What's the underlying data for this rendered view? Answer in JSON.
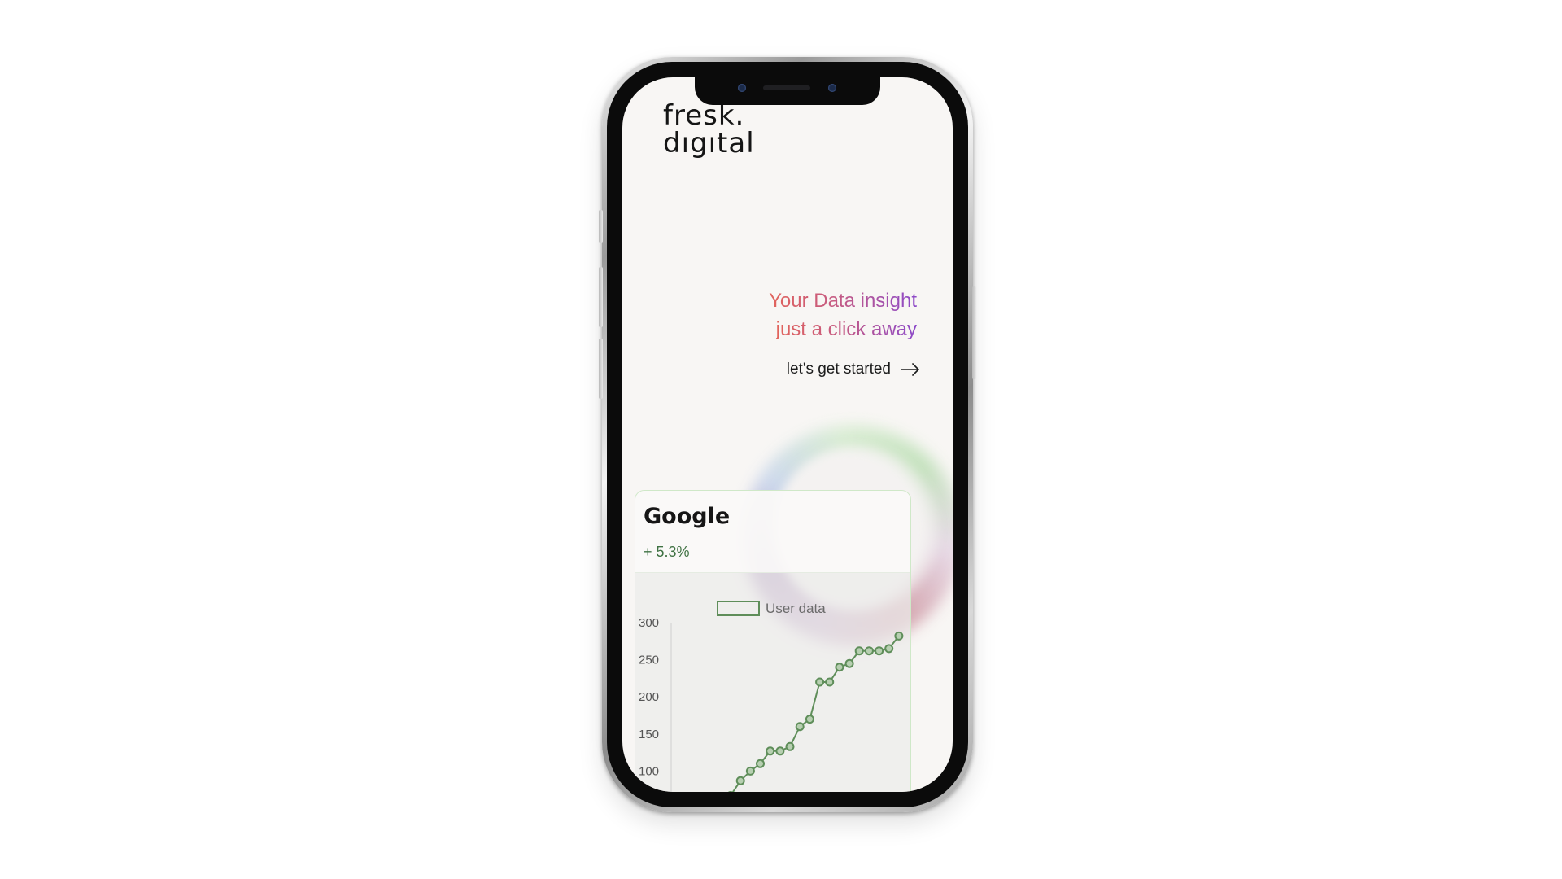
{
  "brand": {
    "logo_line1": "fresk.",
    "logo_line2": "dıgıtal"
  },
  "hero": {
    "headline_line1": "Your Data insight",
    "headline_line2": "just a click away",
    "cta_label": "let's get started",
    "cta_icon": "arrow-right-icon",
    "gradient_colors": [
      "#e2635a",
      "#c35a86",
      "#8d4ac9"
    ]
  },
  "card": {
    "title": "Google",
    "change": "+ 5.3%"
  },
  "chart_data": {
    "type": "line",
    "legend": "User data",
    "series": [
      {
        "name": "User data",
        "color": "#5f8e5a",
        "points": [
          {
            "x": 1,
            "y": 67
          },
          {
            "x": 2,
            "y": 87
          },
          {
            "x": 3,
            "y": 100
          },
          {
            "x": 4,
            "y": 110
          },
          {
            "x": 5,
            "y": 127
          },
          {
            "x": 6,
            "y": 127
          },
          {
            "x": 7,
            "y": 133
          },
          {
            "x": 8,
            "y": 160
          },
          {
            "x": 9,
            "y": 170
          },
          {
            "x": 10,
            "y": 220
          },
          {
            "x": 11,
            "y": 220
          },
          {
            "x": 12,
            "y": 240
          },
          {
            "x": 13,
            "y": 245
          },
          {
            "x": 14,
            "y": 262
          },
          {
            "x": 15,
            "y": 262
          },
          {
            "x": 16,
            "y": 262
          },
          {
            "x": 17,
            "y": 265
          },
          {
            "x": 18,
            "y": 282
          }
        ]
      }
    ],
    "yticks": [
      "300",
      "250",
      "200",
      "150",
      "100"
    ],
    "ylim": [
      50,
      300
    ],
    "xlim": [
      -5,
      18.5
    ],
    "grid": false,
    "legend_position": "top-center"
  }
}
